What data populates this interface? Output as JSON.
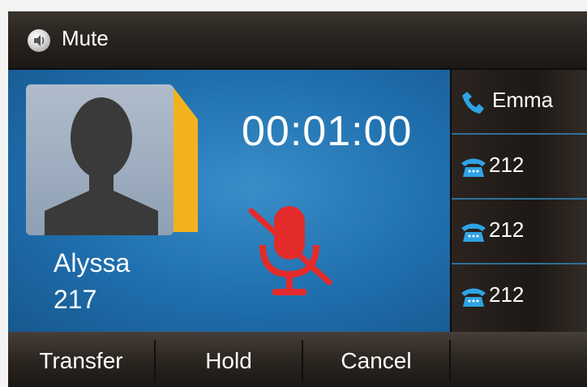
{
  "topbar": {
    "title": "Mute",
    "icon": "speaker-icon"
  },
  "call": {
    "caller_name": "Alyssa",
    "caller_number": "217",
    "duration": "00:01:00",
    "muted": true,
    "mute_color": "#e32b2b",
    "accent_color": "#f3b21d"
  },
  "lines": [
    {
      "label": "Emma",
      "icon": "handset-icon",
      "active": true
    },
    {
      "label": "212",
      "icon": "desk-phone-icon",
      "active": false
    },
    {
      "label": "212",
      "icon": "desk-phone-icon",
      "active": false
    },
    {
      "label": "212",
      "icon": "desk-phone-icon",
      "active": false
    }
  ],
  "softkeys": [
    {
      "label": "Transfer"
    },
    {
      "label": "Hold"
    },
    {
      "label": "Cancel"
    },
    {
      "label": ""
    }
  ]
}
